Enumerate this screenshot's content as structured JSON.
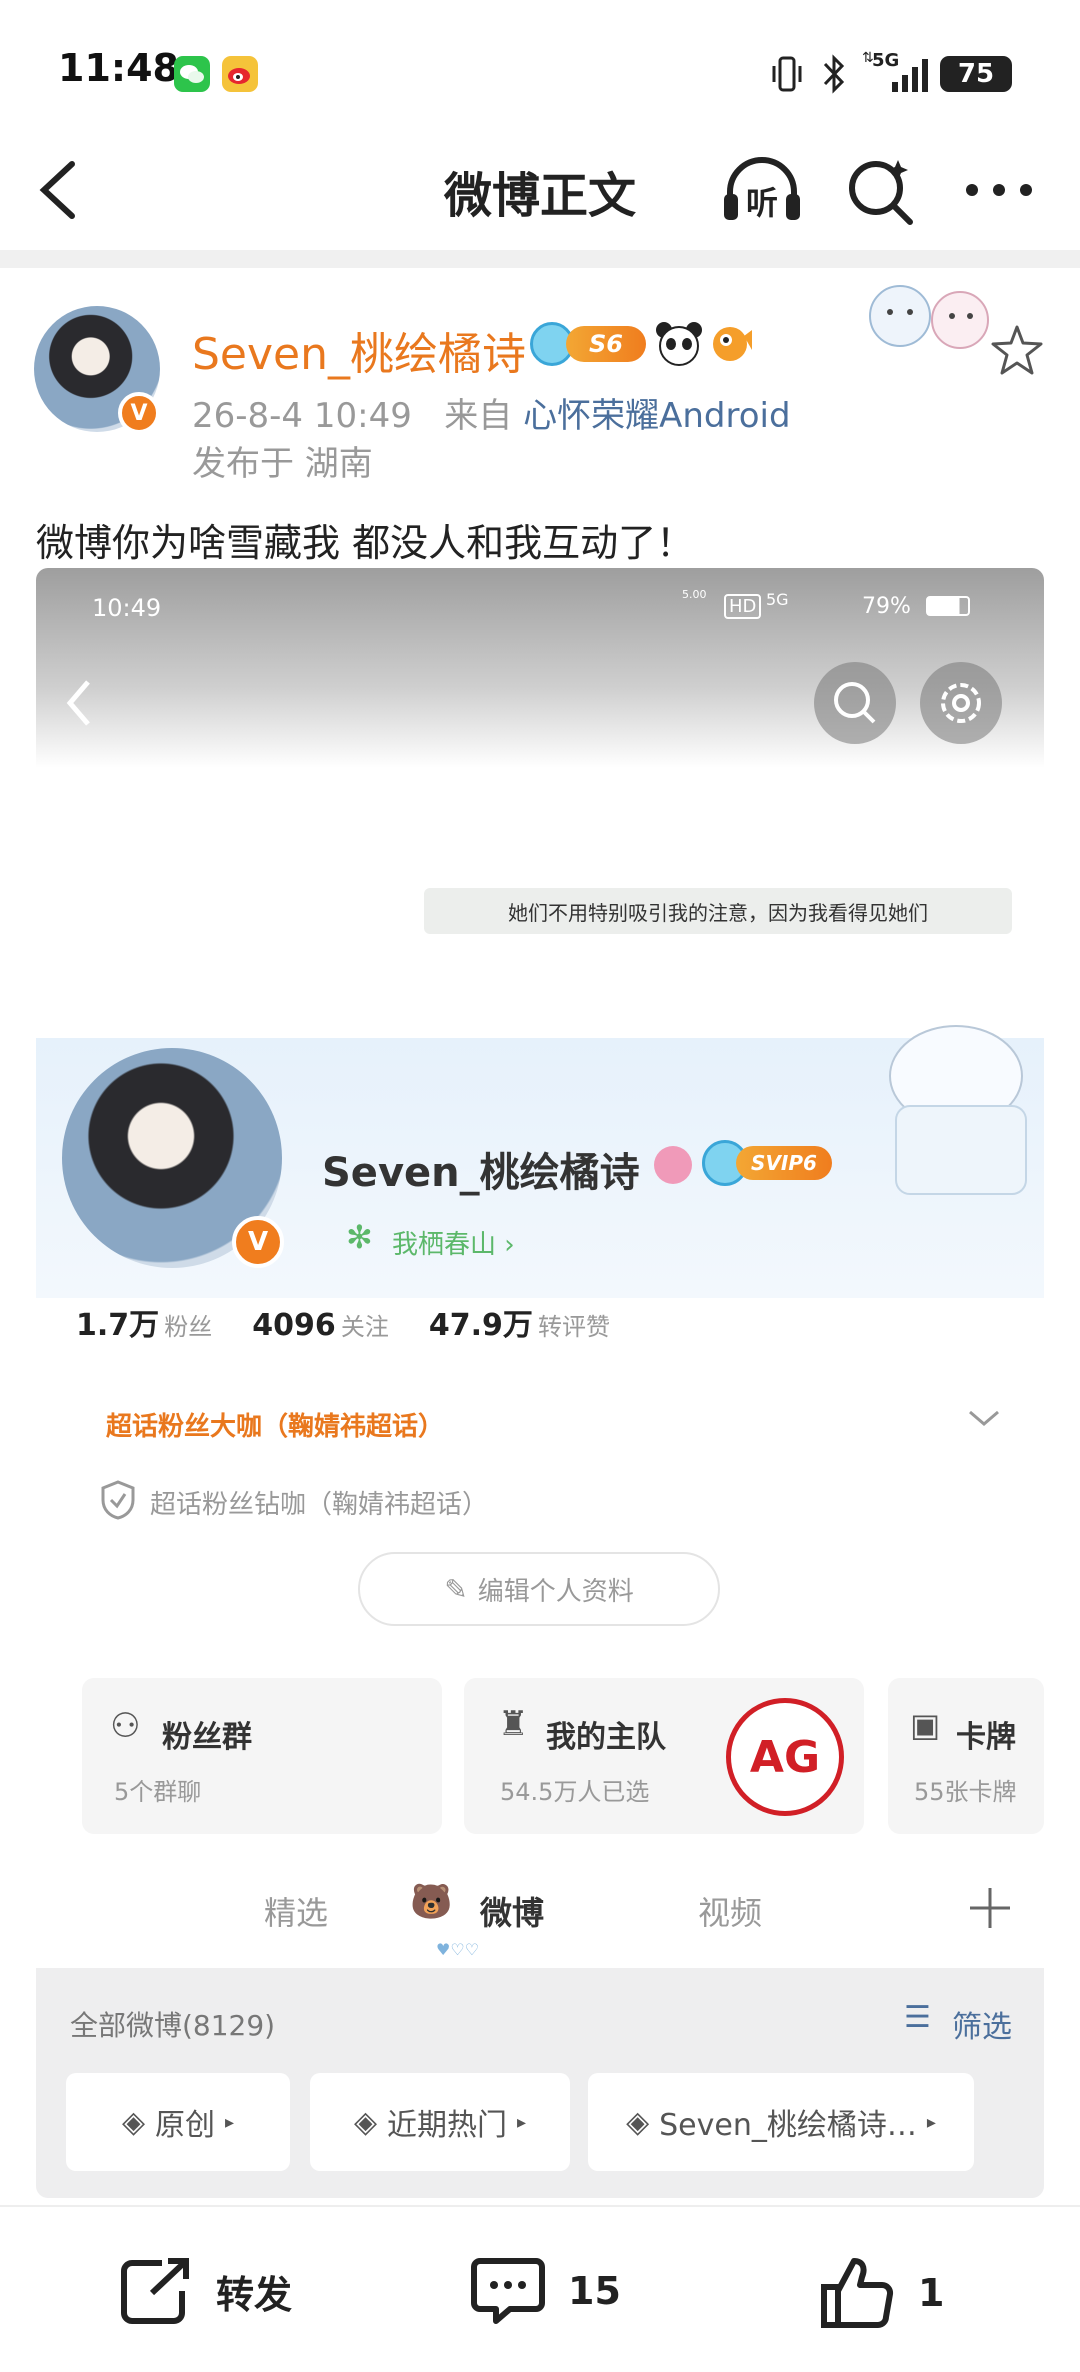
{
  "status_bar": {
    "time": "11:48",
    "network": "5G",
    "battery": "75",
    "icons": [
      "wechat-icon",
      "weibo-icon",
      "vibrate-icon",
      "bluetooth-icon",
      "data-arrows-icon",
      "signal-icon",
      "battery-icon"
    ]
  },
  "nav": {
    "title": "微博正文",
    "listen_label": "听",
    "icons": [
      "back-icon",
      "listen-icon",
      "search-icon",
      "more-icon"
    ]
  },
  "post": {
    "author": "Seven_桃绘橘诗",
    "level_badge": "S6",
    "verified_mark": "V",
    "time": "26-8-4 10:49",
    "from_label": "来自",
    "source": "心怀荣耀Android",
    "location": "发布于 湖南",
    "text": "微博你为啥雪藏我 都没人和我互动了！"
  },
  "embedded_screenshot": {
    "status_time": "10:49",
    "status_speed": "5.00",
    "status_hd": "HD",
    "status_net": "5G",
    "status_battery": "79%",
    "bio": "她们不用特别吸引我的注意，因为我看得见她们",
    "username": "Seven_桃绘橘诗",
    "svip": "SVIP6",
    "verified_mark": "V",
    "tagline": "我栖春山 ›",
    "stats": [
      {
        "value": "1.7万",
        "label": "粉丝"
      },
      {
        "value": "4096",
        "label": "关注"
      },
      {
        "value": "47.9万",
        "label": "转评赞"
      }
    ],
    "super_fan_primary": "超话粉丝大咖（鞠婧祎超话）",
    "super_fan_secondary": "超话粉丝钻咖（鞠婧祎超话）",
    "edit_profile": "编辑个人资料",
    "cards": [
      {
        "title": "粉丝群",
        "sub": "5个群聊"
      },
      {
        "title": "我的主队",
        "sub": "54.5万人已选"
      },
      {
        "title": "卡牌",
        "sub": "55张卡牌"
      }
    ],
    "team_logo_text": "AG",
    "tabs": [
      "精选",
      "微博",
      "视频"
    ],
    "all_weibo": "全部微博(8129)",
    "filter": "筛选",
    "chips": [
      "原创",
      "近期热门",
      "Seven_桃绘橘诗…"
    ]
  },
  "actions": {
    "repost": "转发",
    "comments": "15",
    "likes": "1"
  }
}
